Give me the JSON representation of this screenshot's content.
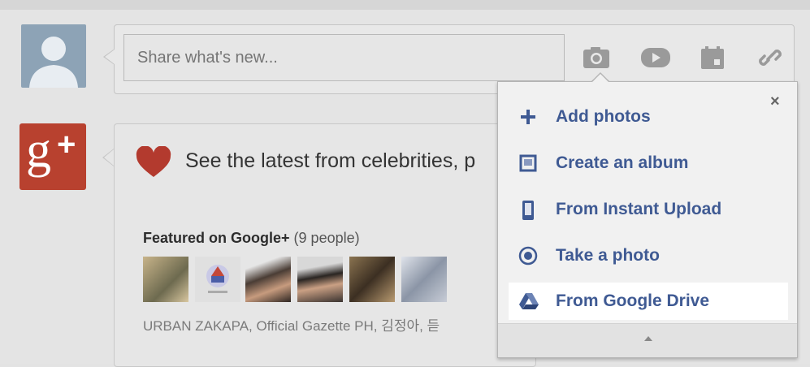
{
  "share": {
    "placeholder": "Share what's new...",
    "icons": [
      "camera-icon",
      "video-icon",
      "event-icon",
      "link-icon"
    ]
  },
  "feed": {
    "latest_text": "See the latest from celebrities, p",
    "featured_title": "Featured on Google+",
    "featured_count": "(9 people)",
    "people_line": "URBAN ZAKAPA, Official Gazette PH, 김정아, 듣"
  },
  "popup": {
    "close_label": "×",
    "items": [
      {
        "label": "Add photos",
        "icon": "plus-icon"
      },
      {
        "label": "Create an album",
        "icon": "album-icon"
      },
      {
        "label": "From Instant Upload",
        "icon": "phone-icon"
      },
      {
        "label": "Take a photo",
        "icon": "camera-circle-icon"
      },
      {
        "label": "From Google Drive",
        "icon": "google-drive-icon"
      }
    ]
  },
  "colors": {
    "accent_blue": "#3f5a93",
    "google_plus_red": "#b8412f",
    "heart_red": "#b33a2e",
    "avatar_blue": "#8da3b6"
  }
}
